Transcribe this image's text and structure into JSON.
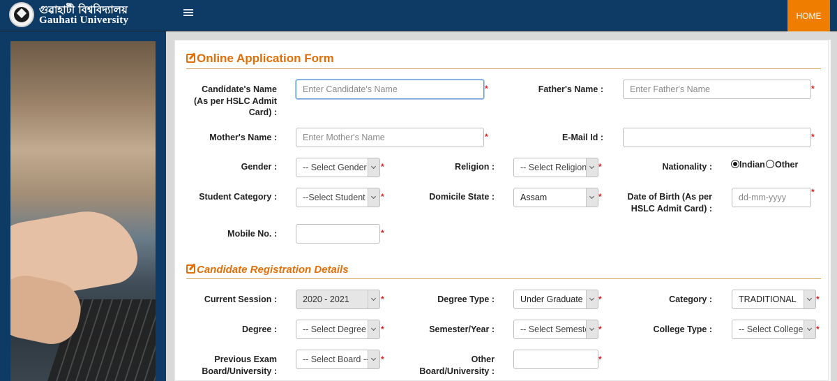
{
  "header": {
    "brand_bengali": "গুৱাহাটী বিশ্ববিদ্যালয়",
    "brand_english": "Gauhati University",
    "home_label": "HOME"
  },
  "sections": {
    "online_form_title": "Online Application Form",
    "registration_title": "Candidate Registration Details"
  },
  "form": {
    "candidate_name": {
      "label": "Candidate's Name (As per HSLC Admit Card) :",
      "placeholder": "Enter Candidate's Name"
    },
    "father_name": {
      "label": "Father's Name :",
      "placeholder": "Enter Father's Name"
    },
    "mother_name": {
      "label": "Mother's Name :",
      "placeholder": "Enter Mother's Name"
    },
    "email": {
      "label": "E-Mail Id :",
      "value": ""
    },
    "gender": {
      "label": "Gender :",
      "value": "-- Select Gender --"
    },
    "religion": {
      "label": "Religion :",
      "value": "-- Select Religion --"
    },
    "nationality": {
      "label": "Nationality :",
      "options": [
        "Indian",
        "Other"
      ],
      "selected": "Indian"
    },
    "student_category": {
      "label": "Student Category :",
      "value": "--Select Student Category--"
    },
    "domicile_state": {
      "label": "Domicile State :",
      "value": "Assam"
    },
    "dob": {
      "label": "Date of Birth (As per HSLC Admit Card) :",
      "placeholder": "dd-mm-yyyy"
    },
    "mobile": {
      "label": "Mobile No. :",
      "value": ""
    },
    "required_mark": "*"
  },
  "registration": {
    "current_session": {
      "label": "Current Session :",
      "value": "2020 - 2021"
    },
    "degree_type": {
      "label": "Degree Type :",
      "value": "Under Graduate"
    },
    "category": {
      "label": "Category :",
      "value": "TRADITIONAL"
    },
    "degree": {
      "label": "Degree :",
      "value": "-- Select Degree --"
    },
    "semester_year": {
      "label": "Semester/Year :",
      "value": "-- Select Semester --"
    },
    "college_type": {
      "label": "College Type :",
      "value": "-- Select College Type --"
    },
    "previous_exam": {
      "label": "Previous Exam Board/University :",
      "value": "-- Select Board --"
    },
    "other_board": {
      "label": "Other Board/University :",
      "value": ""
    }
  },
  "colors": {
    "navy": "#0d3b66",
    "accent_orange": "#ef7d00",
    "section_title": "#e06f0a",
    "required": "#e02020"
  }
}
